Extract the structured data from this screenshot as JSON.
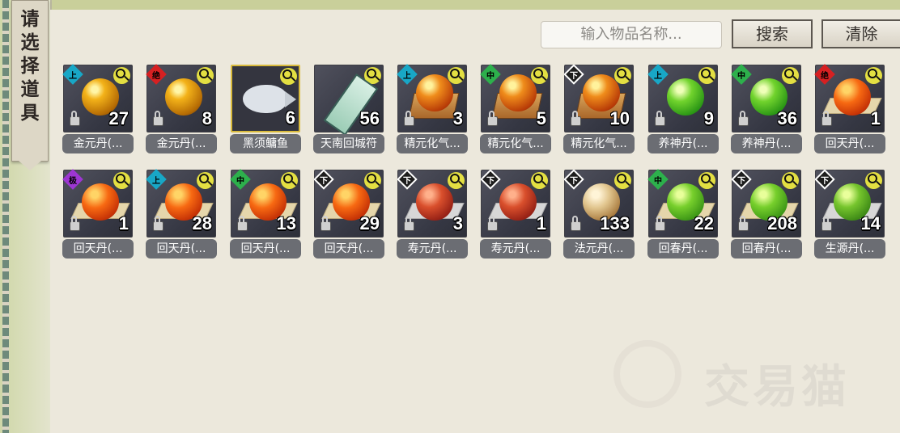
{
  "header": {
    "title": "请选择道具",
    "search_placeholder": "输入物品名称...",
    "search_button": "搜索",
    "clear_button": "清除"
  },
  "items": [
    {
      "name": "金元丹(...",
      "count": "27",
      "grade": "上",
      "grade_color": "#18a7c6",
      "icon": "gold-orb-icon"
    },
    {
      "name": "金元丹(...",
      "count": "8",
      "grade": "绝",
      "grade_color": "#d62022",
      "icon": "gold-orb-icon"
    },
    {
      "name": "黑须鳙鱼",
      "count": "6",
      "grade": "",
      "grade_color": "",
      "icon": "fish-icon",
      "selected": true
    },
    {
      "name": "天南回城符",
      "count": "56",
      "grade": "",
      "grade_color": "",
      "icon": "talisman-icon"
    },
    {
      "name": "精元化气...",
      "count": "3",
      "grade": "上",
      "grade_color": "#18a7c6",
      "icon": "orange-orb-box-icon"
    },
    {
      "name": "精元化气...",
      "count": "5",
      "grade": "中",
      "grade_color": "#2db04c",
      "icon": "orange-orb-box-icon"
    },
    {
      "name": "精元化气...",
      "count": "10",
      "grade": "下",
      "grade_color": "#ffffff",
      "icon": "orange-orb-box-icon"
    },
    {
      "name": "养神丹(...",
      "count": "9",
      "grade": "上",
      "grade_color": "#18a7c6",
      "icon": "green-orb-icon"
    },
    {
      "name": "养神丹(...",
      "count": "36",
      "grade": "中",
      "grade_color": "#2db04c",
      "icon": "green-orb-icon"
    },
    {
      "name": "回天丹(...",
      "count": "1",
      "grade": "绝",
      "grade_color": "#d62022",
      "icon": "orange-orb-plate-icon"
    },
    {
      "name": "回天丹(...",
      "count": "1",
      "grade": "极",
      "grade_color": "#9d36d2",
      "icon": "orange-orb-plate-icon"
    },
    {
      "name": "回天丹(...",
      "count": "28",
      "grade": "上",
      "grade_color": "#18a7c6",
      "icon": "orange-orb-plate-icon"
    },
    {
      "name": "回天丹(...",
      "count": "13",
      "grade": "中",
      "grade_color": "#2db04c",
      "icon": "orange-orb-plate-icon"
    },
    {
      "name": "回天丹(...",
      "count": "29",
      "grade": "下",
      "grade_color": "#ffffff",
      "icon": "orange-orb-plate-icon"
    },
    {
      "name": "寿元丹(...",
      "count": "3",
      "grade": "下",
      "grade_color": "#ffffff",
      "icon": "red-orb-silver-plate-icon"
    },
    {
      "name": "寿元丹(...",
      "count": "1",
      "grade": "下",
      "grade_color": "#ffffff",
      "icon": "red-orb-silver-plate-icon"
    },
    {
      "name": "法元丹(...",
      "count": "133",
      "grade": "下",
      "grade_color": "#ffffff",
      "icon": "beige-orb-icon"
    },
    {
      "name": "回春丹(...",
      "count": "22",
      "grade": "中",
      "grade_color": "#2db04c",
      "icon": "green-orb-plate-icon"
    },
    {
      "name": "回春丹(...",
      "count": "208",
      "grade": "下",
      "grade_color": "#ffffff",
      "icon": "green-orb-plate-icon"
    },
    {
      "name": "生源丹(...",
      "count": "14",
      "grade": "下",
      "grade_color": "#ffffff",
      "icon": "green-orb-silver-plate-icon"
    }
  ],
  "watermark": "交易猫"
}
